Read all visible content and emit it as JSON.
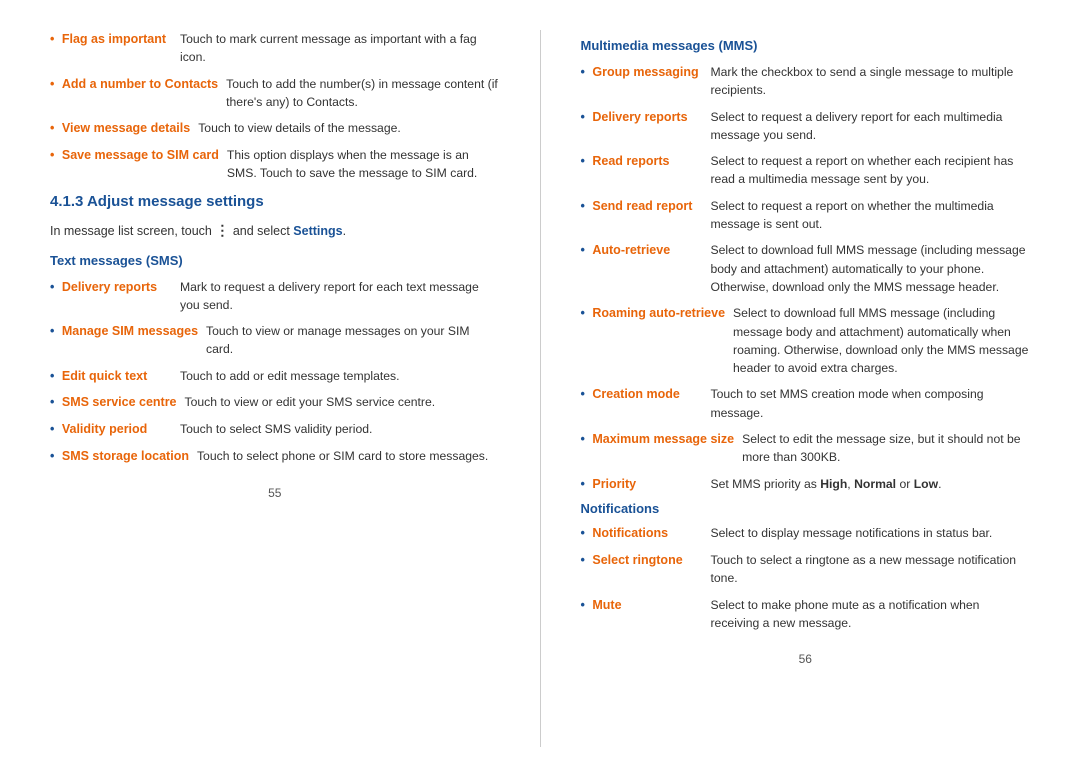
{
  "leftPage": {
    "number": "55",
    "topItems": [
      {
        "label": "Flag as important",
        "desc": "Touch to mark current message as important with a fag icon."
      },
      {
        "label": "Add a number to Contacts",
        "desc": "Touch to add the number(s) in message content (if there's any) to Contacts."
      },
      {
        "label": "View message details",
        "desc": "Touch to view details of the message."
      },
      {
        "label": "Save message to SIM card",
        "desc": "This option displays when the message is an SMS. Touch to save the message to SIM card."
      }
    ],
    "chapterHeading": "4.1.3   Adjust message settings",
    "introText": "In message list screen, touch",
    "introTextMiddle": "and select",
    "introTextLink": "Settings",
    "introTextEnd": ".",
    "smsSection": {
      "title": "Text messages (SMS)",
      "items": [
        {
          "label": "Delivery reports",
          "desc": "Mark to request a delivery report for each text message you send."
        },
        {
          "label": "Manage SIM messages",
          "desc": "Touch to view or manage messages on your SIM card."
        },
        {
          "label": "Edit quick text",
          "desc": "Touch to add or edit message templates."
        },
        {
          "label": "SMS service centre",
          "desc": "Touch to view or edit your SMS service centre."
        },
        {
          "label": "Validity period",
          "desc": "Touch to select SMS validity period."
        },
        {
          "label": "SMS storage location",
          "desc": "Touch to select phone or SIM card to store messages."
        }
      ]
    }
  },
  "rightPage": {
    "number": "56",
    "mmsSection": {
      "title": "Multimedia messages (MMS)",
      "items": [
        {
          "label": "Group messaging",
          "desc": "Mark the checkbox to send a single message to multiple recipients."
        },
        {
          "label": "Delivery reports",
          "desc": "Select to request a delivery report for each multimedia message you send."
        },
        {
          "label": "Read reports",
          "desc": "Select to request a report on whether each recipient has read a multimedia message sent by you."
        },
        {
          "label": "Send read report",
          "desc": "Select to request a report on whether the multimedia message is sent out."
        },
        {
          "label": "Auto-retrieve",
          "desc": "Select to download full MMS message (including message body and attachment) automatically to your phone. Otherwise, download only the MMS message header."
        },
        {
          "label": "Roaming auto-retrieve",
          "desc": "Select to download full MMS message (including message body and attachment) automatically when roaming. Otherwise, download only the MMS message header to avoid extra charges."
        },
        {
          "label": "Creation mode",
          "desc": "Touch to set MMS creation mode when composing message."
        },
        {
          "label": "Maximum message size",
          "desc": "Select to edit the message size, but it should not be more than 300KB."
        },
        {
          "label": "Priority",
          "desc": "Set MMS priority as High, Normal or Low.",
          "descParts": [
            {
              "text": "Set MMS priority as ",
              "bold": false
            },
            {
              "text": "High",
              "bold": true
            },
            {
              "text": ", ",
              "bold": false
            },
            {
              "text": "Normal",
              "bold": true
            },
            {
              "text": " or ",
              "bold": false
            },
            {
              "text": "Low",
              "bold": true
            },
            {
              "text": ".",
              "bold": false
            }
          ]
        }
      ]
    },
    "notificationsSection": {
      "title": "Notifications",
      "items": [
        {
          "label": "Notifications",
          "desc": "Select to display message notifications in status bar."
        },
        {
          "label": "Select ringtone",
          "desc": "Touch to select a ringtone as a new message notification tone."
        },
        {
          "label": "Mute",
          "desc": "Select to make phone mute as a notification when receiving a new message."
        }
      ]
    }
  }
}
